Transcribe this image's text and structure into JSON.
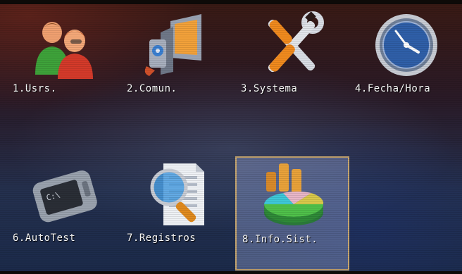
{
  "menu": {
    "items": [
      {
        "label": "1.Usrs.",
        "icon": "users-icon"
      },
      {
        "label": "2.Comun.",
        "icon": "communication-icon"
      },
      {
        "label": "3.Systema",
        "icon": "tools-icon"
      },
      {
        "label": "4.Fecha/Hora",
        "icon": "clock-icon"
      },
      {
        "label": "6.AutoTest",
        "icon": "autotest-icon"
      },
      {
        "label": "7.Registros",
        "icon": "records-magnifier-icon"
      },
      {
        "label": "8.Info.Sist.",
        "icon": "system-info-chart-icon"
      }
    ],
    "selected_label": "8.Info.Sist."
  },
  "colors": {
    "selection_border": "#c9a870",
    "selection_fill": "#96a5d2",
    "label_text": "#ffffff"
  }
}
